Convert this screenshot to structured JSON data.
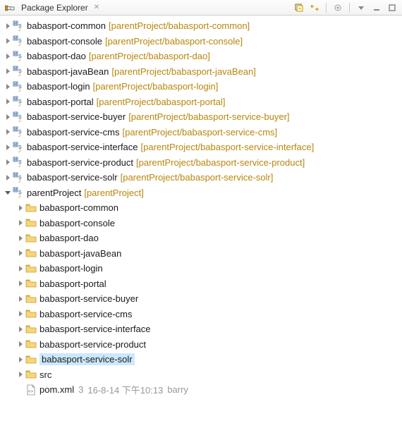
{
  "view": {
    "title": "Package Explorer",
    "close_x": "✕"
  },
  "toolbar": {
    "collapse": "⊟",
    "link": "⇆",
    "menu": "▾"
  },
  "projects": [
    {
      "name": "babasport-common",
      "deco": "[parentProject/babasport-common]"
    },
    {
      "name": "babasport-console",
      "deco": "[parentProject/babasport-console]"
    },
    {
      "name": "babasport-dao",
      "deco": "[parentProject/babasport-dao]"
    },
    {
      "name": "babasport-javaBean",
      "deco": "[parentProject/babasport-javaBean]"
    },
    {
      "name": "babasport-login",
      "deco": "[parentProject/babasport-login]"
    },
    {
      "name": "babasport-portal",
      "deco": "[parentProject/babasport-portal]"
    },
    {
      "name": "babasport-service-buyer",
      "deco": "[parentProject/babasport-service-buyer]"
    },
    {
      "name": "babasport-service-cms",
      "deco": "[parentProject/babasport-service-cms]"
    },
    {
      "name": "babasport-service-interface",
      "deco": "[parentProject/babasport-service-interface]"
    },
    {
      "name": "babasport-service-product",
      "deco": "[parentProject/babasport-service-product]"
    },
    {
      "name": "babasport-service-solr",
      "deco": "[parentProject/babasport-service-solr]"
    }
  ],
  "parent": {
    "name": "parentProject",
    "deco": "[parentProject]"
  },
  "folders": [
    "babasport-common",
    "babasport-console",
    "babasport-dao",
    "babasport-javaBean",
    "babasport-login",
    "babasport-portal",
    "babasport-service-buyer",
    "babasport-service-cms",
    "babasport-service-interface",
    "babasport-service-product",
    "babasport-service-solr",
    "src"
  ],
  "selected_folder_index": 10,
  "pom": {
    "name": "pom.xml",
    "rev": "3",
    "date": "16-8-14 下午10:13",
    "author": "barry"
  }
}
